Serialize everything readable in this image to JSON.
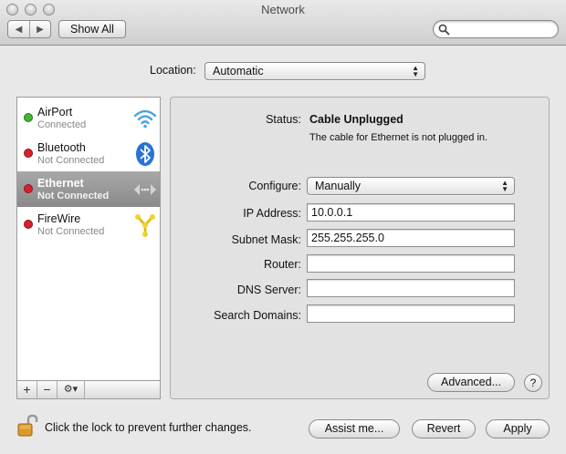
{
  "window": {
    "title": "Network"
  },
  "toolbar": {
    "show_all": "Show All",
    "back_icon": "chevron-left-icon",
    "forward_icon": "chevron-right-icon",
    "search_placeholder": ""
  },
  "location": {
    "label": "Location:",
    "value": "Automatic"
  },
  "services": [
    {
      "name": "AirPort",
      "status": "Connected",
      "status_color": "#3fb72e",
      "icon": "wifi-icon",
      "selected": false
    },
    {
      "name": "Bluetooth",
      "status": "Not Connected",
      "status_color": "#d8202a",
      "icon": "bluetooth-icon",
      "selected": false
    },
    {
      "name": "Ethernet",
      "status": "Not Connected",
      "status_color": "#d8202a",
      "icon": "ethernet-icon",
      "selected": true
    },
    {
      "name": "FireWire",
      "status": "Not Connected",
      "status_color": "#d8202a",
      "icon": "firewire-icon",
      "selected": false
    }
  ],
  "sidebar_buttons": {
    "add": "+",
    "remove": "−",
    "action": "⚙▾"
  },
  "detail": {
    "status_label": "Status:",
    "status_value": "Cable Unplugged",
    "status_desc": "The cable for Ethernet is not plugged in.",
    "configure_label": "Configure:",
    "configure_value": "Manually",
    "ip_label": "IP Address:",
    "ip_value": "10.0.0.1",
    "subnet_label": "Subnet Mask:",
    "subnet_value": "255.255.255.0",
    "router_label": "Router:",
    "router_value": "",
    "dns_label": "DNS Server:",
    "dns_value": "",
    "search_domains_label": "Search Domains:",
    "search_domains_value": "",
    "advanced": "Advanced...",
    "help": "?"
  },
  "footer": {
    "lock_text": "Click the lock to prevent further changes.",
    "assist": "Assist me...",
    "revert": "Revert",
    "apply": "Apply"
  }
}
